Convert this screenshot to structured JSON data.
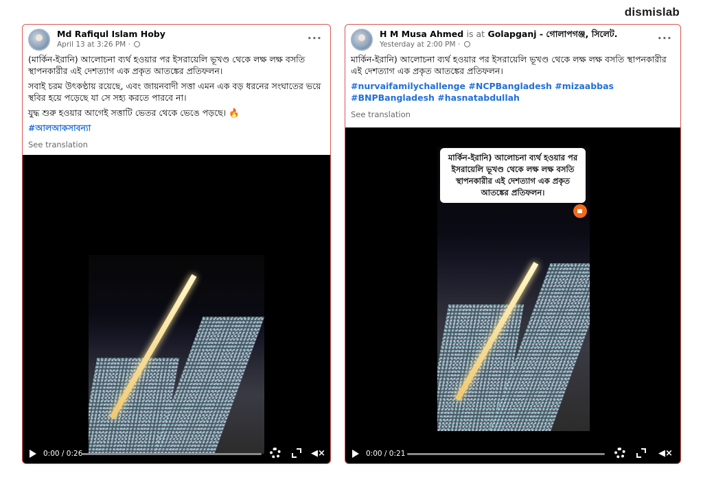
{
  "brand": "dismislab",
  "posts": [
    {
      "author": "Md Rafiqul Islam Hoby",
      "location_prefix": "",
      "location": "",
      "timestamp": "April 13 at 3:26 PM ·",
      "paragraphs": [
        "(মার্কিন-ইরানি) আলোচনা ব্যর্থ হওয়ার পর ইসরায়েলি ভূখণ্ড থেকে লক্ষ লক্ষ বসতি স্থাপনকারীর এই দেশত্যাগ এক প্রকৃত আতঙ্কের প্রতিফলন।",
        "সবাই চরম উৎকণ্ঠায় রয়েছে, এবং জায়নবাদী সত্তা এমন এক বড় ধরনের সংঘাতের ভয়ে স্থবির হয়ে পড়েছে যা সে সহ্য করতে পারবে না।",
        "যুদ্ধ শুরু হওয়ার আগেই সত্তাটি ভেতর থেকে ভেঙে পড়ছে। 🔥"
      ],
      "hashtags": "#আলআকসাবন্যা",
      "see_translation": "See translation",
      "video_time": "0:00 / 0:26",
      "overlay": ""
    },
    {
      "author": "H M Musa Ahmed",
      "location_prefix": "is at",
      "location": "Golapganj - গোলাপগঞ্জ, সিলেট.",
      "timestamp": "Yesterday at 2:00 PM ·",
      "paragraphs": [
        "মার্কিন-ইরানি) আলোচনা ব্যর্থ হওয়ার পর ইসরায়েলি ভূখণ্ড থেকে লক্ষ লক্ষ বসতি স্থাপনকারীর এই দেশত্যাগ এক প্রকৃত আতঙ্কের প্রতিফলন।"
      ],
      "hashtags": "#nurvaifamilychallenge #NCPBangladesh #mizaabbas #BNPBangladesh #hasnatabdullah",
      "see_translation": "See translation",
      "video_time": "0:00 / 0:21",
      "overlay": "মার্কিন-ইরানি) আলোচনা ব্যর্থ হওয়ার পর ইসরায়েলি ভূখণ্ড থেকে লক্ষ লক্ষ বসতি স্থাপনকারীর এই দেশত্যাগ এক প্রকৃত আতঙ্কের প্রতিফলন।"
    }
  ]
}
